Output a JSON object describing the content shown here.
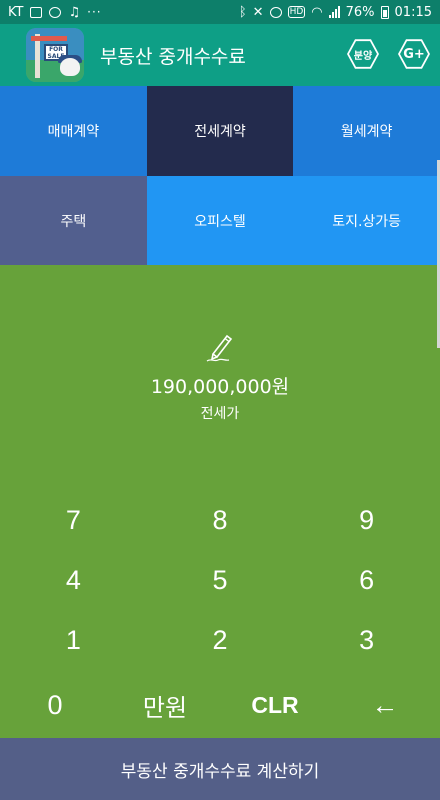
{
  "status_bar": {
    "carrier": "KT",
    "overflow": "···",
    "battery_percent": "76%",
    "time": "01:15",
    "colors": {
      "background": "#0d7f6a"
    }
  },
  "app_bar": {
    "title": "부동산 중개수수료",
    "bunyang_label": "분양",
    "gplus_label": "G+",
    "logo_sign": "FOR SALE",
    "colors": {
      "background": "#0e9f86"
    }
  },
  "contract_tabs": {
    "items": [
      {
        "label": "매매계약",
        "selected": false
      },
      {
        "label": "전세계약",
        "selected": true
      },
      {
        "label": "월세계약",
        "selected": false
      }
    ]
  },
  "property_tabs": {
    "items": [
      {
        "label": "주택",
        "selected": true
      },
      {
        "label": "오피스텔",
        "selected": false
      },
      {
        "label": "토지.상가등",
        "selected": false
      }
    ]
  },
  "display": {
    "amount": "190,000,000원",
    "label": "전세가",
    "icon": "pencil-icon"
  },
  "keypad": {
    "rows": [
      [
        "7",
        "8",
        "9"
      ],
      [
        "4",
        "5",
        "6"
      ],
      [
        "1",
        "2",
        "3"
      ]
    ],
    "last_row": [
      "0",
      "만원",
      "CLR",
      "←"
    ]
  },
  "bottom_button": {
    "label": "부동산 중개수수료 계산하기"
  },
  "colors": {
    "keypad_bg": "#67a23a",
    "tab_selected": "#232b4d",
    "tab_blue": "#1e7bd8",
    "tab_slate": "#525f8e",
    "tab_light": "#2196f3",
    "bottom_bar": "#545f88"
  }
}
